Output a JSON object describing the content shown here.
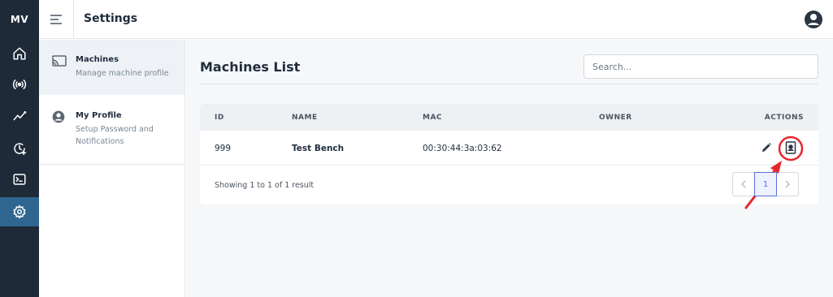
{
  "brand": {
    "logo": "MV"
  },
  "rail": {
    "items": [
      {
        "icon": "home-icon",
        "active": false
      },
      {
        "icon": "broadcast-icon",
        "active": false
      },
      {
        "icon": "trend-chart-icon",
        "active": false
      },
      {
        "icon": "history-clock-icon",
        "active": false
      },
      {
        "icon": "terminal-icon",
        "active": false
      },
      {
        "icon": "gear-icon",
        "active": true
      }
    ]
  },
  "topbar": {
    "title": "Settings",
    "menu_icon": "menu-icon",
    "user_icon": "user-icon"
  },
  "sidebar": {
    "items": [
      {
        "title": "Machines",
        "subtitle": "Manage machine profile",
        "icon": "cast-icon",
        "active": true
      },
      {
        "title": "My Profile",
        "subtitle": "Setup Password and Notifications",
        "icon": "user-circle-icon",
        "active": false
      }
    ]
  },
  "main": {
    "title": "Machines List",
    "search": {
      "placeholder": "Search...",
      "value": ""
    },
    "table": {
      "columns": [
        "ID",
        "NAME",
        "MAC",
        "OWNER",
        "ACTIONS"
      ],
      "rows": [
        {
          "id": "999",
          "name": "Test Bench",
          "mac": "00:30:44:3a:03:62",
          "owner": ""
        }
      ]
    },
    "footer": {
      "showing": "Showing 1 to 1 of 1 result",
      "current_page": "1",
      "prev_icon": "chevron-left-icon",
      "next_icon": "chevron-right-icon"
    }
  },
  "colors": {
    "rail_bg": "#1e2a38",
    "rail_active": "#2f6690",
    "annotation_red": "#e8262d",
    "pager_accent": "#5a6fd6"
  }
}
